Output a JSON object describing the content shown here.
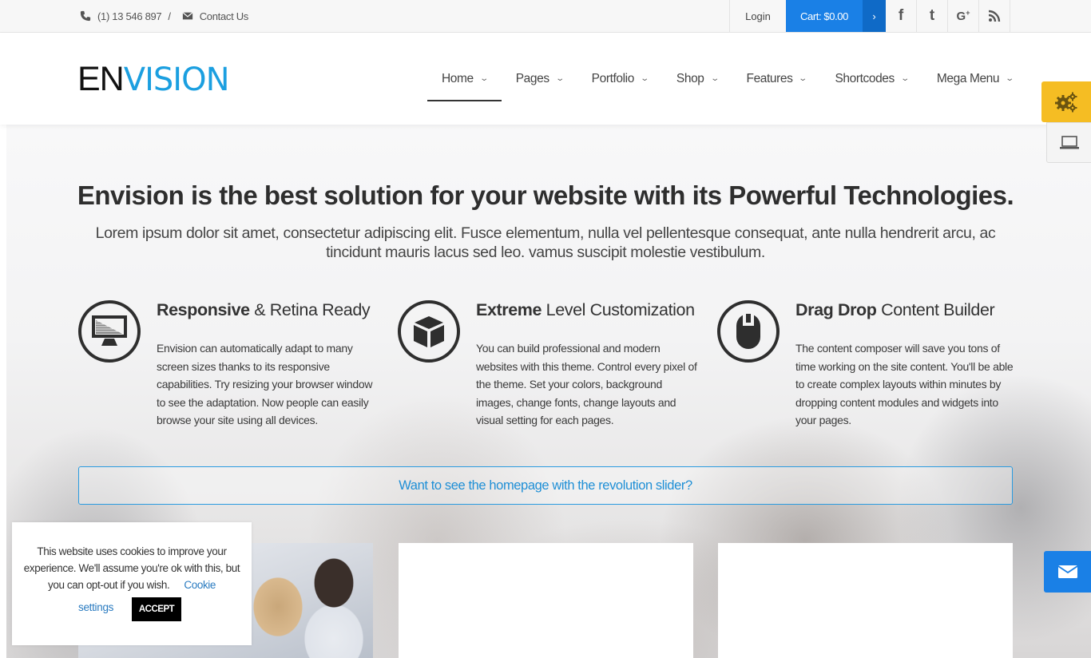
{
  "topbar": {
    "phone": "(1) 13 546 897",
    "separator": "/",
    "contact_label": "Contact Us",
    "login_label": "Login",
    "cart_label": "Cart: $0.00",
    "cart_arrow": "›",
    "social": [
      {
        "name": "facebook",
        "glyph": "f"
      },
      {
        "name": "twitter",
        "glyph": "t"
      },
      {
        "name": "google-plus",
        "glyph": "G+"
      },
      {
        "name": "rss",
        "glyph": "rss"
      }
    ]
  },
  "header": {
    "logo_part1": "EN",
    "logo_part2": "VISION",
    "nav": [
      {
        "label": "Home",
        "active": true
      },
      {
        "label": "Pages"
      },
      {
        "label": "Portfolio"
      },
      {
        "label": "Shop"
      },
      {
        "label": "Features"
      },
      {
        "label": "Shortcodes"
      },
      {
        "label": "Mega Menu"
      }
    ],
    "chevron": "⌄"
  },
  "hero": {
    "title": "Envision is the best solution for your website with its Powerful Technologies.",
    "subtitle": "Lorem ipsum dolor sit amet, consectetur adipiscing elit. Fusce elementum, nulla vel pellentesque consequat, ante nulla hendrerit arcu, ac tincidunt mauris lacus sed leo. vamus suscipit molestie vestibulum."
  },
  "features": [
    {
      "icon": "monitor-icon",
      "title_bold": "Responsive",
      "title_rest": " & Retina Ready",
      "description": "Envision can automatically adapt to many screen sizes thanks to its responsive capabilities. Try resizing your browser window to see the adaptation. Now people can easily browse your site using all devices."
    },
    {
      "icon": "cube-icon",
      "title_bold": "Extreme",
      "title_rest": " Level Customization",
      "description": "You can build professional and modern websites with this theme. Control every pixel of the theme. Set your colors, background images, change fonts, change layouts and visual setting for each pages."
    },
    {
      "icon": "mouse-icon",
      "title_bold": "Drag Drop",
      "title_rest": " Content Builder",
      "description": "The content composer will save you tons of time working on the site content. You'll be able to create complex layouts within minutes by dropping content modules and widgets into your pages."
    }
  ],
  "revolution_link": "Want to see the homepage with the revolution slider?",
  "cookie": {
    "text": "This website uses cookies to improve your experience. We'll assume you're ok with this, but you can opt-out if you wish.",
    "settings_part1": "Cookie",
    "settings_part2": "settings",
    "accept_label": "ACCEPT"
  },
  "colors": {
    "accent_blue": "#1a80e6",
    "logo_blue": "#1b9fe0",
    "settings_yellow": "#f5bd23"
  }
}
